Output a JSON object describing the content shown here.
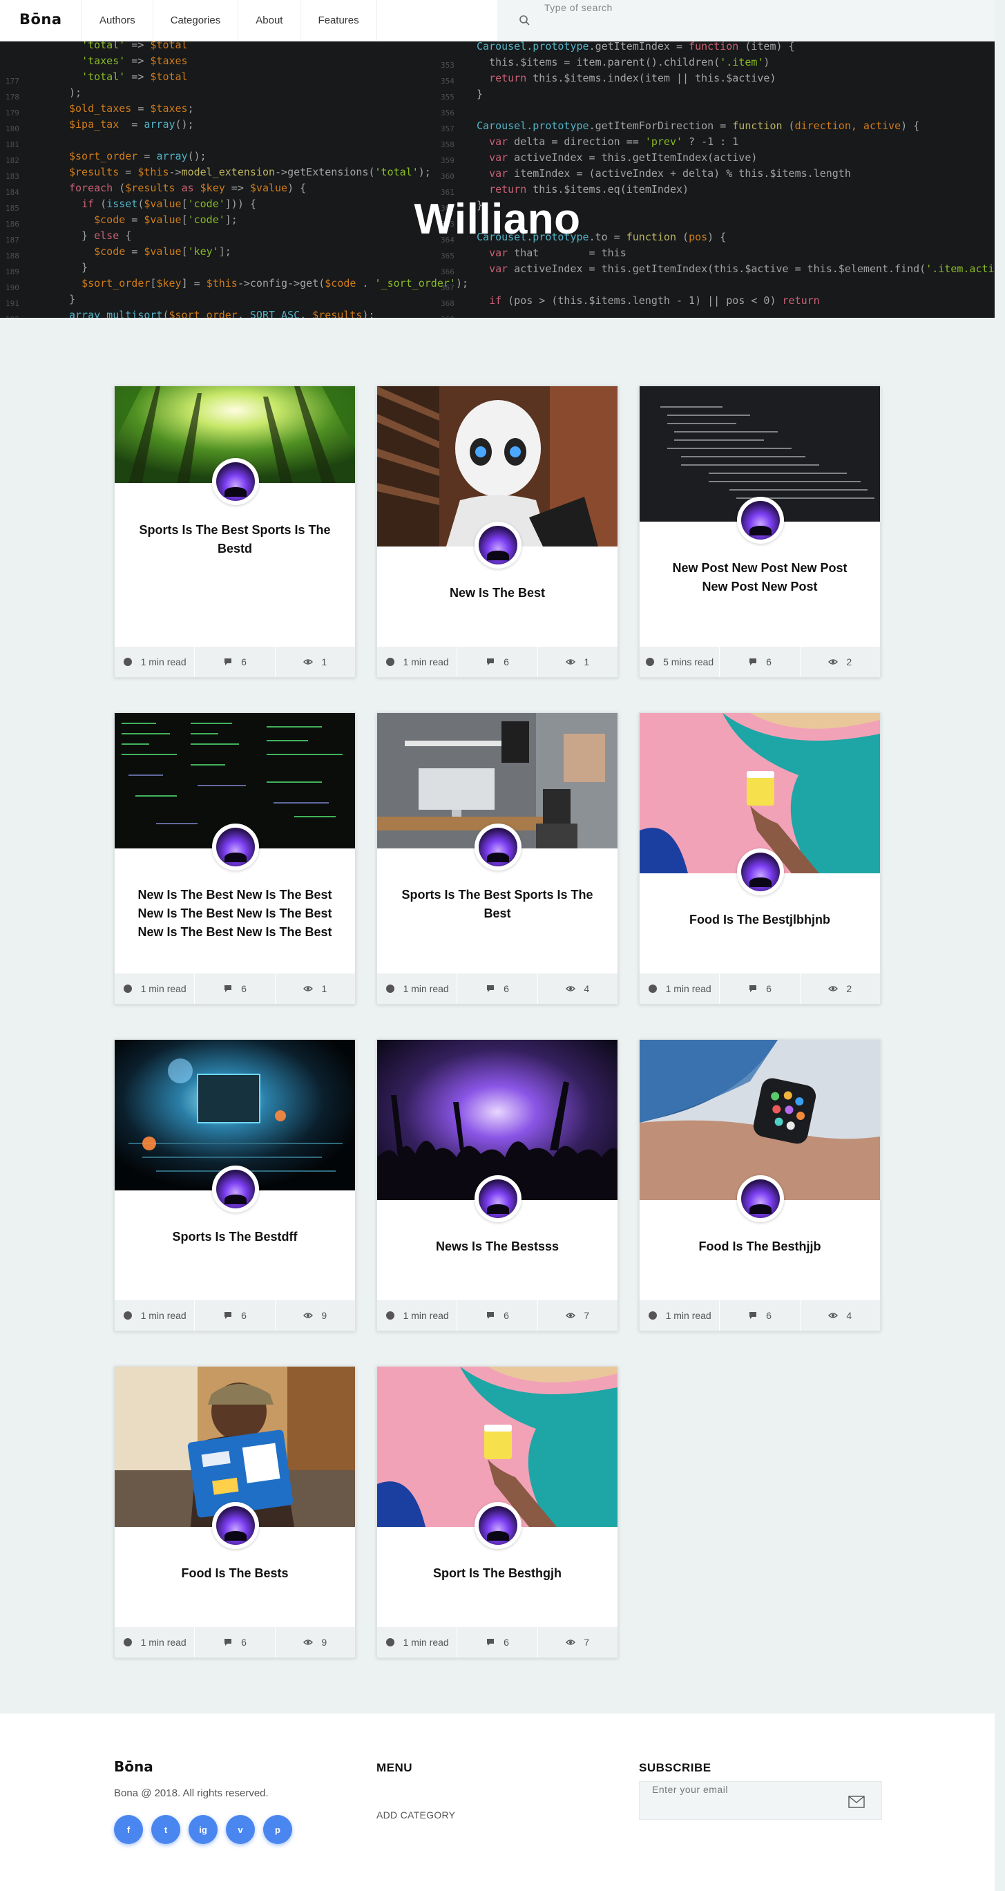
{
  "header": {
    "logo": "Bōna",
    "nav": [
      "Authors",
      "Categories",
      "About",
      "Features"
    ],
    "search_placeholder": "Type of search"
  },
  "hero": {
    "title": "Williano"
  },
  "posts": [
    {
      "title": "Sports Is The Best Sports Is The Bestd",
      "read": "1 min read",
      "comments": "6",
      "views": "1",
      "image": "forest-sunlight"
    },
    {
      "title": "New Is The Best",
      "read": "1 min read",
      "comments": "6",
      "views": "1",
      "image": "robot"
    },
    {
      "title": "New Post New Post New Post New Post New Post",
      "read": "5 mins read",
      "comments": "6",
      "views": "2",
      "image": "code-screen"
    },
    {
      "title": "New Is The Best New Is The Best New Is The Best New Is The Best New Is The Best New Is The Best",
      "read": "1 min read",
      "comments": "6",
      "views": "1",
      "image": "matrix-code"
    },
    {
      "title": "Sports Is The Best Sports Is The Best",
      "read": "1 min read",
      "comments": "6",
      "views": "4",
      "image": "desk-workspace"
    },
    {
      "title": "Food Is The Bestjlbhjnb",
      "read": "1 min read",
      "comments": "6",
      "views": "2",
      "image": "coffee-cup-wall"
    },
    {
      "title": "Sports Is The Bestdff",
      "read": "1 min read",
      "comments": "6",
      "views": "9",
      "image": "circuit-board"
    },
    {
      "title": "News Is The Bestsss",
      "read": "1 min read",
      "comments": "6",
      "views": "7",
      "image": "concert-crowd"
    },
    {
      "title": "Food Is The Besthjjb",
      "read": "1 min read",
      "comments": "6",
      "views": "4",
      "image": "smartwatch"
    },
    {
      "title": "Food Is The Bests",
      "read": "1 min read",
      "comments": "6",
      "views": "9",
      "image": "woman-laptop"
    },
    {
      "title": "Sport Is The Besthgjh",
      "read": "1 min read",
      "comments": "6",
      "views": "7",
      "image": "coffee-cup-wall"
    }
  ],
  "footer": {
    "logo": "Bōna",
    "copyright": "Bona @ 2018. All rights reserved.",
    "menu_heading": "MENU",
    "menu_link": "ADD CATEGORY",
    "subscribe_heading": "SUBSCRIBE",
    "email_placeholder": "Enter your email",
    "socials": [
      "f",
      "t",
      "ig",
      "v",
      "p"
    ],
    "social_names": [
      "facebook",
      "twitter",
      "instagram",
      "vimeo",
      "pinterest"
    ]
  },
  "colors": {
    "accent": "#4a86f0",
    "page_bg": "#ecf1f1",
    "hero_bg": "#1d1f21"
  }
}
